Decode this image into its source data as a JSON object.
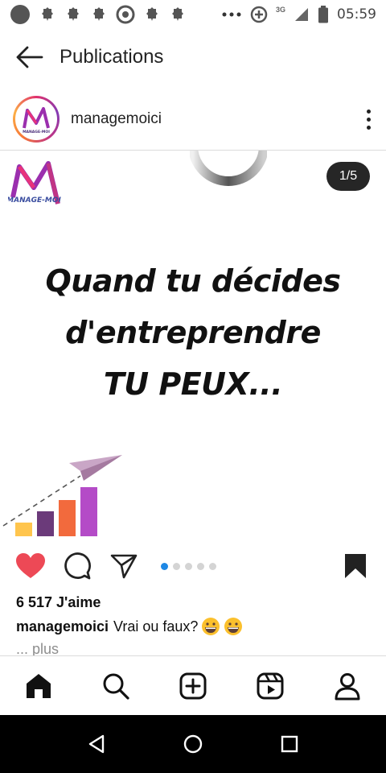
{
  "status_bar": {
    "time": "05:59",
    "network_type": "3G",
    "icons": [
      "circle-icon",
      "notification-bell-icon",
      "notification-bell-icon",
      "notification-bell-icon",
      "chrome-icon",
      "notification-bell-icon",
      "notification-bell-icon",
      "more-dots-icon",
      "data-saver-icon",
      "signal-icon",
      "battery-icon"
    ]
  },
  "header": {
    "title": "Publications",
    "back_icon": "arrow-left-icon"
  },
  "post": {
    "username": "managemoici",
    "counter": "1/5",
    "image_text": {
      "line1": "Quand tu décides",
      "line2": "d'entreprendre",
      "line3": "TU PEUX..."
    },
    "logo_text": "MANAGE-MOI",
    "carousel": {
      "count": 5,
      "active": 1
    },
    "likes": "6 517 J'aime",
    "caption_user": "managemoici",
    "caption_text": "Vrai ou faux?",
    "more_label": "... plus"
  },
  "colors": {
    "like": "#ed4956",
    "accent_dot": "#1e88e5",
    "bar_yellow": "#ffc54d",
    "bar_purple": "#6b3a7a",
    "bar_orange": "#f26a3d",
    "bar_violet": "#b44bc7"
  },
  "bottom_nav": [
    "home-icon",
    "search-icon",
    "add-post-icon",
    "reels-icon",
    "profile-icon"
  ],
  "system_nav": [
    "back-triangle-icon",
    "home-circle-icon",
    "recents-square-icon"
  ]
}
